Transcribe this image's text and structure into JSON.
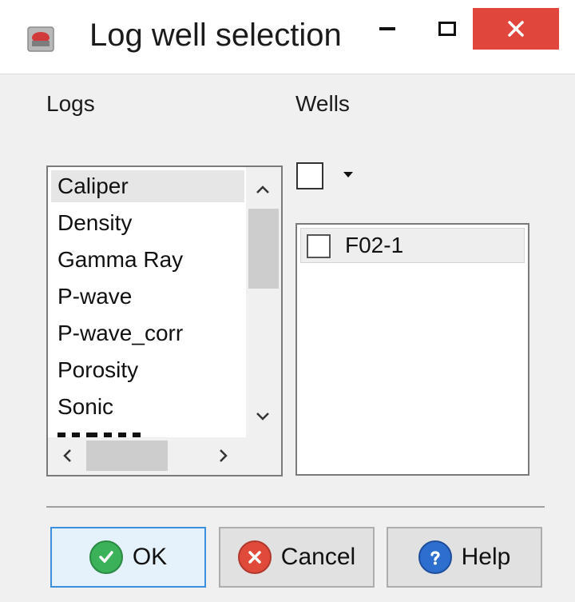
{
  "window": {
    "title": "Log well selection",
    "close_color": "#e0463b"
  },
  "logs": {
    "label": "Logs",
    "items": [
      "Caliper",
      "Density",
      "Gamma Ray",
      "P-wave",
      "P-wave_corr",
      "Porosity",
      "Sonic"
    ],
    "selected": "Caliper"
  },
  "wells": {
    "label": "Wells",
    "select_all_checked": false,
    "items": [
      {
        "name": "F02-1",
        "checked": false
      }
    ]
  },
  "buttons": {
    "ok": "OK",
    "cancel": "Cancel",
    "help": "Help"
  },
  "icons": {
    "app": "log-well-app-icon",
    "ok": "green-check-icon",
    "cancel": "red-x-icon",
    "help": "blue-question-icon"
  }
}
